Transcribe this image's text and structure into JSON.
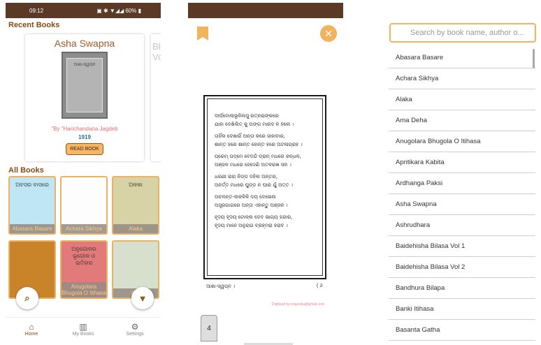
{
  "home": {
    "status": {
      "time": "09:12",
      "battery": "60%"
    },
    "recent_title": "Recent Books",
    "recent_book": {
      "title": "Asha Swapna",
      "cover_text": "ଆଶା-ସ୍ୱପ୍ନ",
      "author": "\"By \"Harichandana Jagdeb",
      "year": "1919",
      "read_label": "READ BOOK"
    },
    "recent_peek": "Bł Vo",
    "all_title": "All Books",
    "tiles": [
      {
        "label": "Abasara Basare",
        "bg": "#bfe6f4",
        "cover_text": "ଅବସର ବାସରେ"
      },
      {
        "label": "Achara Sikhya",
        "bg": "#fdfdfd",
        "cover_text": ""
      },
      {
        "label": "Alaka",
        "bg": "#d8d3a6",
        "cover_text": "ଅଳକା"
      },
      {
        "label": "",
        "bg": "#c9842a",
        "cover_text": ""
      },
      {
        "label": "Anugolara Bhugola O Itihasa",
        "bg": "#e37a7a",
        "cover_text": "ଅନୁଗୋଳର ଭୂଗୋଳ ଓ ଇତିହାସ"
      },
      {
        "label": "Apri",
        "bg": "#d7e0cc",
        "cover_text": ""
      }
    ],
    "nav": [
      {
        "label": "Home",
        "icon": "home-icon",
        "glyph": "⌂"
      },
      {
        "label": "My Books",
        "icon": "books-icon",
        "glyph": "▥"
      },
      {
        "label": "Settings",
        "icon": "gear-icon",
        "glyph": "⚙"
      }
    ]
  },
  "reader": {
    "lines": [
      "ଦୀର୍ଘବୋଲାଭୂଳିଲସୁ ରତ୍ନରାଙ୍କରେ",
      "ଯାହା ଦେଖିଲିତ୍ କୁ ଅଙ୍ଗ ମାରଦ ନ ହଲେ ।",
      "",
      "ତାହିଁଲ ଦେଖାରିଁ ଅନ୍ତା କରେ ଜାହାବାର,",
      "ଶାନ୍ତ ହରେ ଶାନ୍ତ ହୋନ୍ତ ହରେ ଅଟଳାଗ୍ରହ ।",
      "",
      "ପ୍ରେମ୍ ପଦ୍ମେ ବେଦନ୍ଦି ଡ୍ରାନ୍ ମଧରେ କନ୍ଧଳ,",
      "ଅଞ୍ଜଳ ମଧରେ ହେଦେଣି ଅତଳରଖ ସଳ ।",
      "",
      "ଧରଣୀ ରାରା ନିଡ୍ଡ ଦହିଲ ଅନ୍ତର,",
      "ଅନର୍ତ୍ତ ମଧରେ ଘୁଡ୍ଡ ନ ଘାର ଯୁଁ ଅତ୍ତ ।",
      "",
      "ଅଚଳନ୍ତ-ଲକଳିଳି ଦୟ ଦେଭେଲ",
      "ଅସ୍ତ୍ରଗାଗରେ ଅନ୍ତା ଏହାନ୍ତୁ ଅଞ୍ଜଳ ।",
      "",
      "ହୃଦୟ ହୃଦୟ ଟୋଳ୍ଲ ଦେବ ଭାଗ୍ୟ ହନ୍ଦାର,",
      "ହୃଦୟ ମାନେ ଅନୁରାଗ ବ୍ରହ୍ମରା ହରାବ ।"
    ],
    "footer_left": "ଆଶା-ସ୍ୱପ୍ନ ।",
    "footer_right": "( ୬",
    "digitized": "Digitized by srujanika@gmail.com",
    "page_number": "4"
  },
  "search": {
    "placeholder": "Search by book name, author o...",
    "books": [
      "Abasara Basare",
      "Achara Sikhya",
      "Alaka",
      "Ama Deha",
      "Anugolara Bhugola O Itihasa",
      "Apritikara Kabita",
      "Ardhanga Paksi",
      "Asha Swapna",
      "Ashrudhara",
      "Baidehisha Bilasa Vol 1",
      "Baidehisha Bilasa Vol 2",
      "Bandhura Bilapa",
      "Banki Itihasa",
      "Basanta Gatha"
    ]
  }
}
